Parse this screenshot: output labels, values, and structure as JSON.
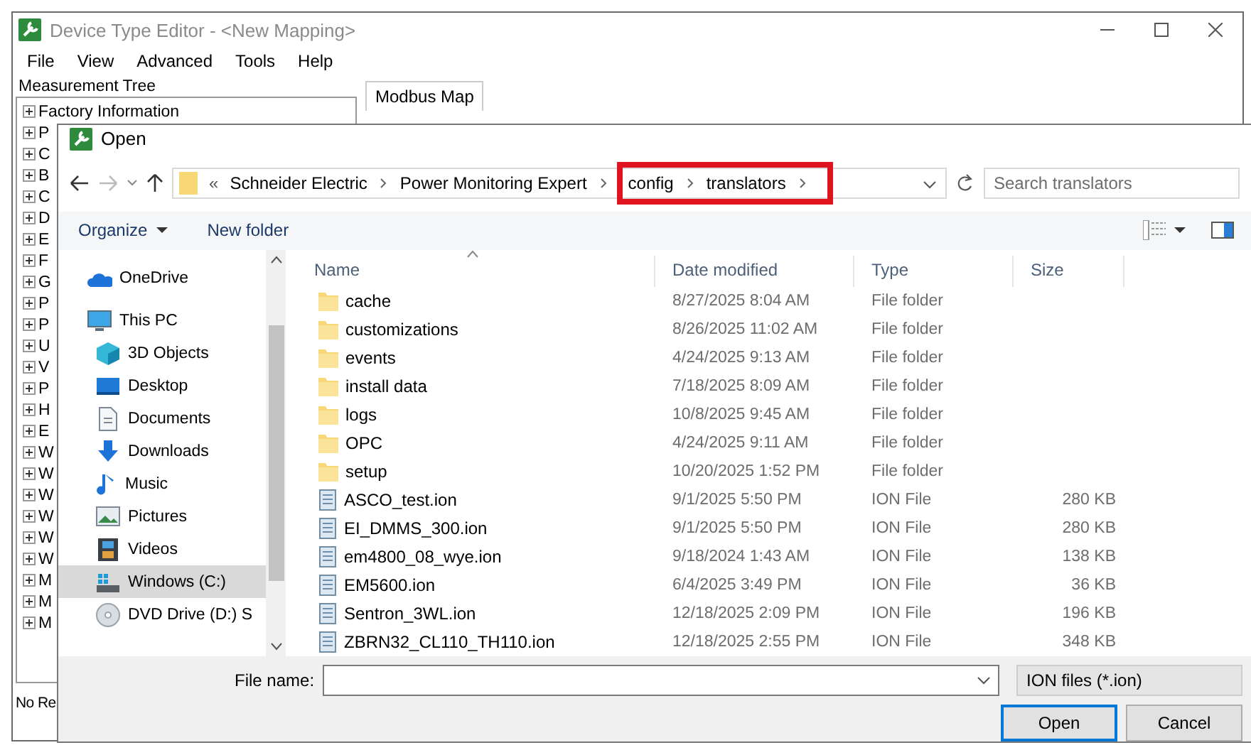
{
  "window": {
    "title": "Device Type Editor - <New Mapping>"
  },
  "menu": [
    "File",
    "View",
    "Advanced",
    "Tools",
    "Help"
  ],
  "measurement_tree": {
    "title": "Measurement Tree",
    "items": [
      "Factory Information",
      "P",
      "C",
      "B",
      "C",
      "D",
      "E",
      "F",
      "G",
      "P",
      "P",
      "U",
      "V",
      "P",
      "H",
      "E",
      "W",
      "W",
      "W",
      "W",
      "W",
      "W",
      "M",
      "M",
      "M"
    ]
  },
  "tabs": [
    {
      "label": "Modbus Map",
      "selected": true
    }
  ],
  "status_bar": "No Re",
  "dialog": {
    "title": "Open",
    "address": {
      "overflow": "«",
      "crumbs": [
        {
          "label": "Schneider Electric",
          "highlighted": false
        },
        {
          "label": "Power Monitoring Expert",
          "highlighted": false
        },
        {
          "label": "config",
          "highlighted": true
        },
        {
          "label": "translators",
          "highlighted": true
        }
      ]
    },
    "search": {
      "placeholder": "Search translators"
    },
    "toolbar": {
      "organize": "Organize",
      "new_folder": "New folder"
    },
    "nav": [
      {
        "label": "OneDrive",
        "kind": "cloud",
        "selected": false
      },
      {
        "label": "This PC",
        "kind": "pc",
        "selected": false,
        "children": [
          {
            "label": "3D Objects",
            "kind": "cube",
            "selected": false
          },
          {
            "label": "Desktop",
            "kind": "desktop",
            "selected": false
          },
          {
            "label": "Documents",
            "kind": "documents",
            "selected": false
          },
          {
            "label": "Downloads",
            "kind": "downloads",
            "selected": false
          },
          {
            "label": "Music",
            "kind": "music",
            "selected": false
          },
          {
            "label": "Pictures",
            "kind": "pictures",
            "selected": false
          },
          {
            "label": "Videos",
            "kind": "videos",
            "selected": false
          },
          {
            "label": "Windows (C:)",
            "kind": "drive",
            "selected": true
          },
          {
            "label": "DVD Drive (D:) S",
            "kind": "dvd",
            "selected": false
          }
        ]
      }
    ],
    "columns": [
      "Name",
      "Date modified",
      "Type",
      "Size"
    ],
    "files": [
      {
        "name": "cache",
        "date": "8/27/2025 8:04 AM",
        "type": "File folder",
        "kind": "folder"
      },
      {
        "name": "customizations",
        "date": "8/26/2025 11:02 AM",
        "type": "File folder",
        "kind": "folder"
      },
      {
        "name": "events",
        "date": "4/24/2025 9:13 AM",
        "type": "File folder",
        "kind": "folder"
      },
      {
        "name": "install data",
        "date": "7/18/2025 8:09 AM",
        "type": "File folder",
        "kind": "folder"
      },
      {
        "name": "logs",
        "date": "10/8/2025 9:45 AM",
        "type": "File folder",
        "kind": "folder"
      },
      {
        "name": "OPC",
        "date": "4/24/2025 9:11 AM",
        "type": "File folder",
        "kind": "folder"
      },
      {
        "name": "setup",
        "date": "10/20/2025 1:52 PM",
        "type": "File folder",
        "kind": "folder"
      },
      {
        "name": "ASCO_test.ion",
        "date": "9/1/2025 5:50 PM",
        "type": "ION File",
        "size": "280 KB",
        "kind": "file"
      },
      {
        "name": "EI_DMMS_300.ion",
        "date": "9/1/2025 5:50 PM",
        "type": "ION File",
        "size": "280 KB",
        "kind": "file"
      },
      {
        "name": "em4800_08_wye.ion",
        "date": "9/18/2024 1:43 AM",
        "type": "ION File",
        "size": "138 KB",
        "kind": "file"
      },
      {
        "name": "EM5600.ion",
        "date": "6/4/2025 3:49 PM",
        "type": "ION File",
        "size": "36 KB",
        "kind": "file"
      },
      {
        "name": "Sentron_3WL.ion",
        "date": "12/18/2025 2:09 PM",
        "type": "ION File",
        "size": "196 KB",
        "kind": "file"
      },
      {
        "name": "ZBRN32_CL110_TH110.ion",
        "date": "12/18/2025 2:55 PM",
        "type": "ION File",
        "size": "348 KB",
        "kind": "file"
      }
    ],
    "file_name": {
      "label": "File name:"
    },
    "file_type": "ION files (*.ion)",
    "buttons": [
      {
        "label": "Open",
        "kind": "default"
      },
      {
        "label": "Cancel",
        "kind": "normal"
      }
    ]
  }
}
